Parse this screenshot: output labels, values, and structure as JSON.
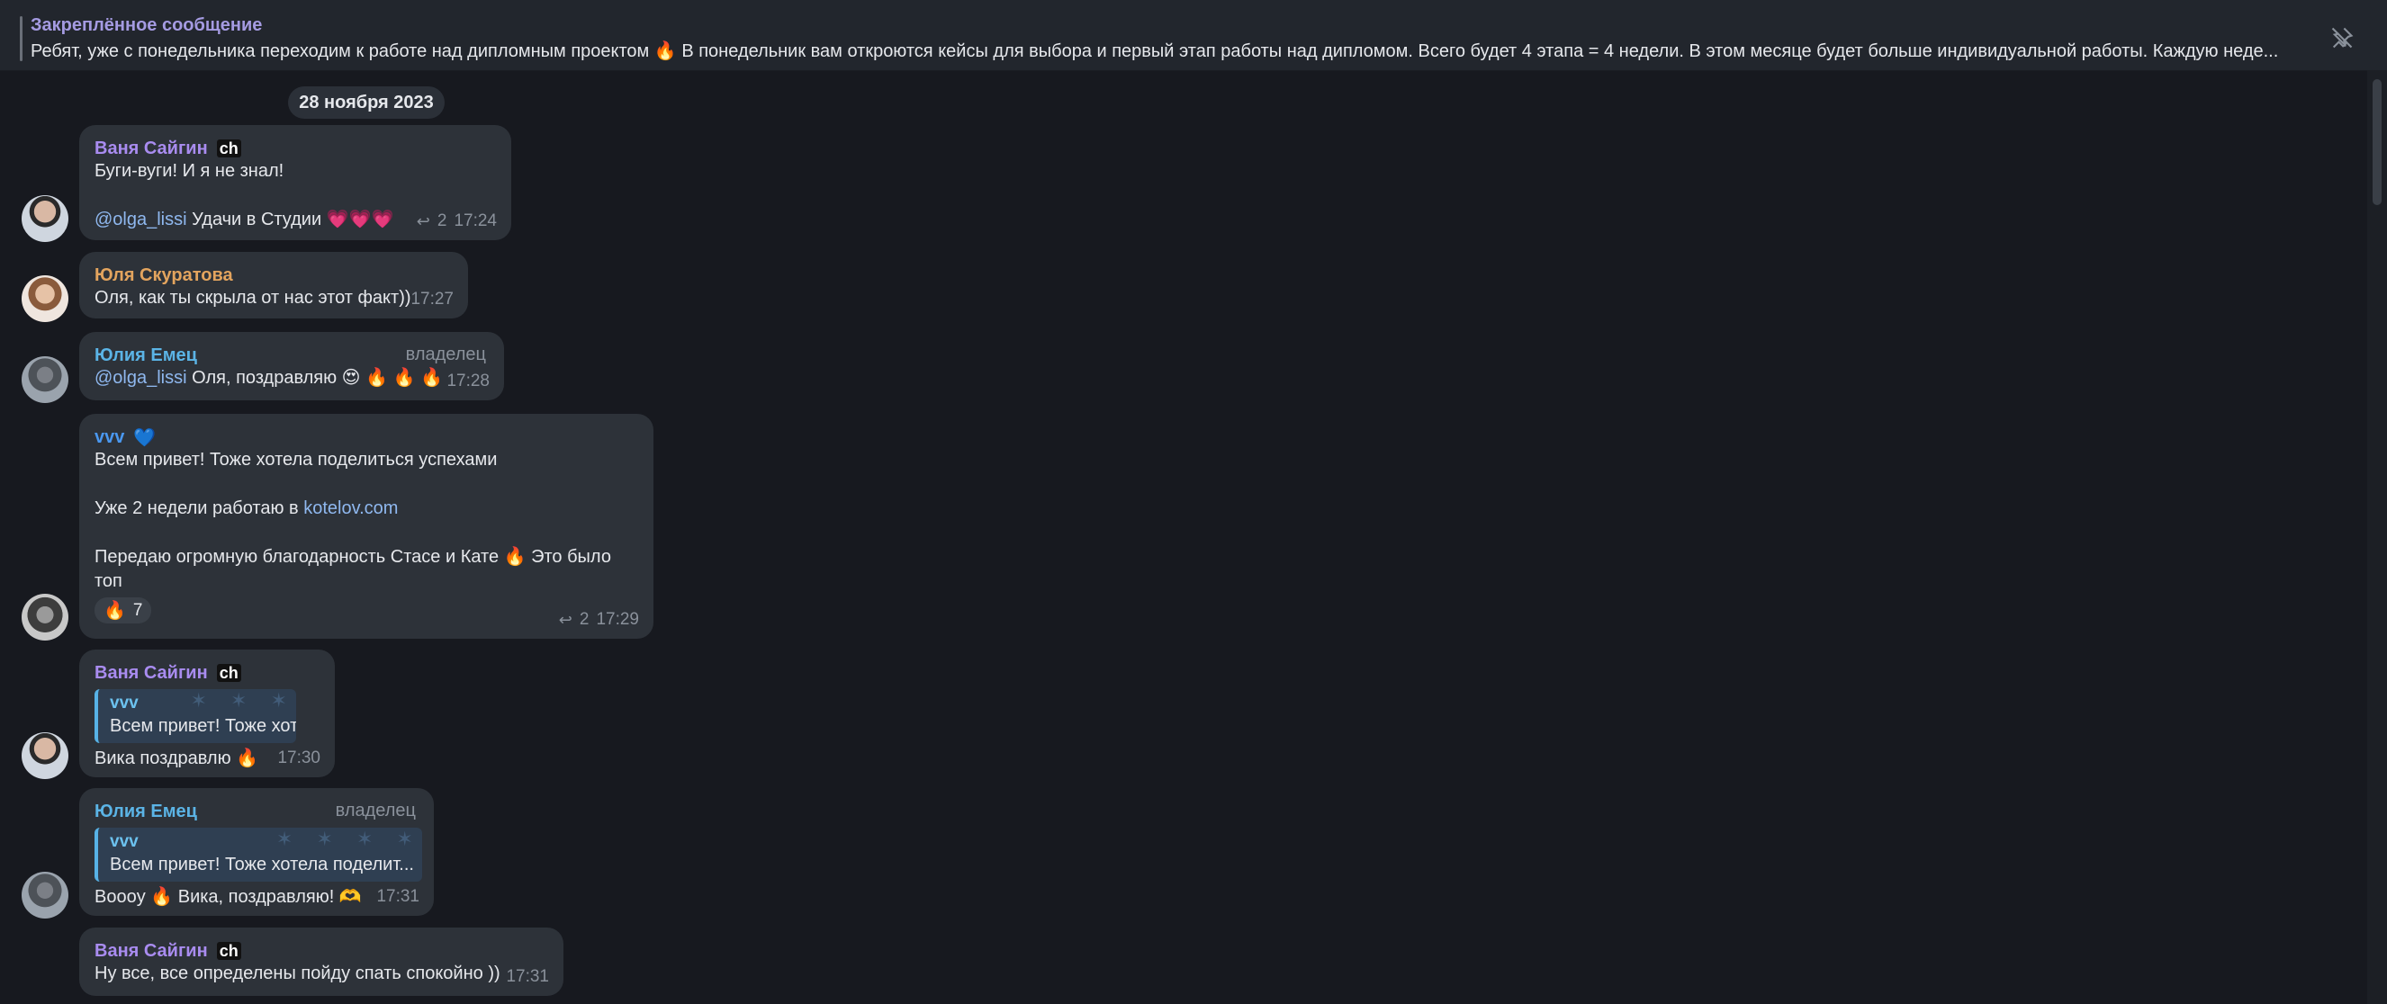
{
  "pinned": {
    "title": "Закреплённое сообщение",
    "text": "Ребят, уже с понедельника переходим к работе над дипломным проектом 🔥   В понедельник вам откроются кейсы для выбора и первый этап работы над дипломом.   Всего будет 4 этапа = 4 недели.  В этом месяце будет больше индивидуальной работы. Каждую неде..."
  },
  "date_divider": "28 ноября 2023",
  "messages": [
    {
      "sender": "Ваня Сайгин",
      "badge": "ch",
      "lines": [
        "Буги-вуги! И я не знал!",
        "",
        "Удачи в Студии 💗💗💗"
      ],
      "mention": "@olga_lissi",
      "replies": "2",
      "time": "17:24"
    },
    {
      "sender": "Юля Скуратова",
      "lines": [
        "Оля, как ты скрыла от нас этот факт))"
      ],
      "time": "17:27"
    },
    {
      "sender": "Юлия Емец",
      "role": "владелец",
      "mention": "@olga_lissi",
      "lines": [
        "Оля, поздравляю 😍 🔥 🔥 🔥"
      ],
      "time": "17:28"
    },
    {
      "sender": "vvv",
      "badge_emoji": "💙",
      "lines": [
        "Всем привет! Тоже хотела поделиться успехами",
        "",
        "Уже 2 недели работаю в ",
        "",
        "Передаю огромную благодарность Стасе и Кате 🔥 Это было",
        "топ"
      ],
      "link": "kotelov.com",
      "reaction_emoji": "🔥",
      "reaction_count": "7",
      "replies": "2",
      "time": "17:29"
    },
    {
      "sender": "Ваня Сайгин",
      "badge": "ch",
      "quote_name": "vvv",
      "quote_text": "Всем привет! Тоже хот...",
      "lines": [
        "Вика поздравлю 🔥"
      ],
      "time": "17:30"
    },
    {
      "sender": "Юлия Емец",
      "role": "владелец",
      "quote_name": "vvv",
      "quote_text": "Всем привет! Тоже хотела поделит...",
      "lines": [
        "Вoooу 🔥 Вика, поздравляю! 🫶"
      ],
      "time": "17:31"
    },
    {
      "sender": "Ваня Сайгин",
      "badge": "ch",
      "lines": [
        "Ну все, все определены пойду спать спокойно ))"
      ],
      "time": "17:31"
    }
  ],
  "icons": {
    "pin": "pin-off-icon",
    "reply": "reply-arrow-icon"
  },
  "colors": {
    "background": "#17191f",
    "bubble": "#2d3239",
    "purple_name": "#a98cf0",
    "orange_name": "#e3a45e",
    "cyan_name": "#5bb4e6",
    "link": "#8fb8ef"
  }
}
